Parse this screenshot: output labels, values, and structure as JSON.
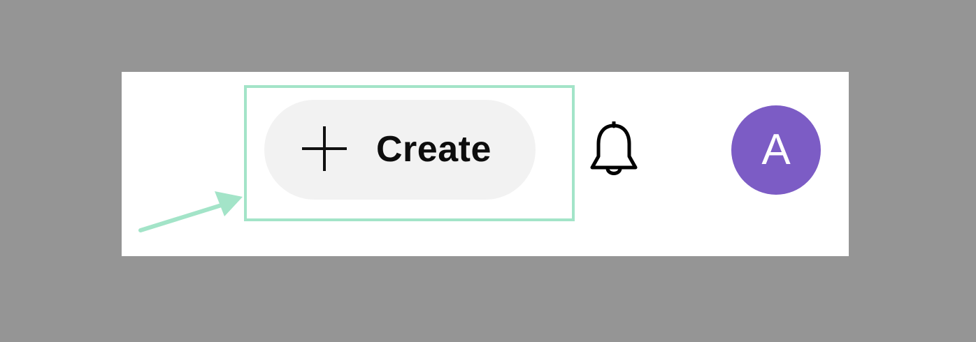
{
  "toolbar": {
    "create_label": "Create",
    "create_icon": "plus-icon",
    "notifications_icon": "bell-icon"
  },
  "user": {
    "avatar_initial": "A"
  },
  "annotation": {
    "arrow_icon": "arrow-icon",
    "highlight_color": "#a3e4c8"
  },
  "colors": {
    "backdrop": "#959595",
    "panel": "#ffffff",
    "button_bg": "#f2f2f2",
    "avatar_bg": "#7c5cc5"
  }
}
